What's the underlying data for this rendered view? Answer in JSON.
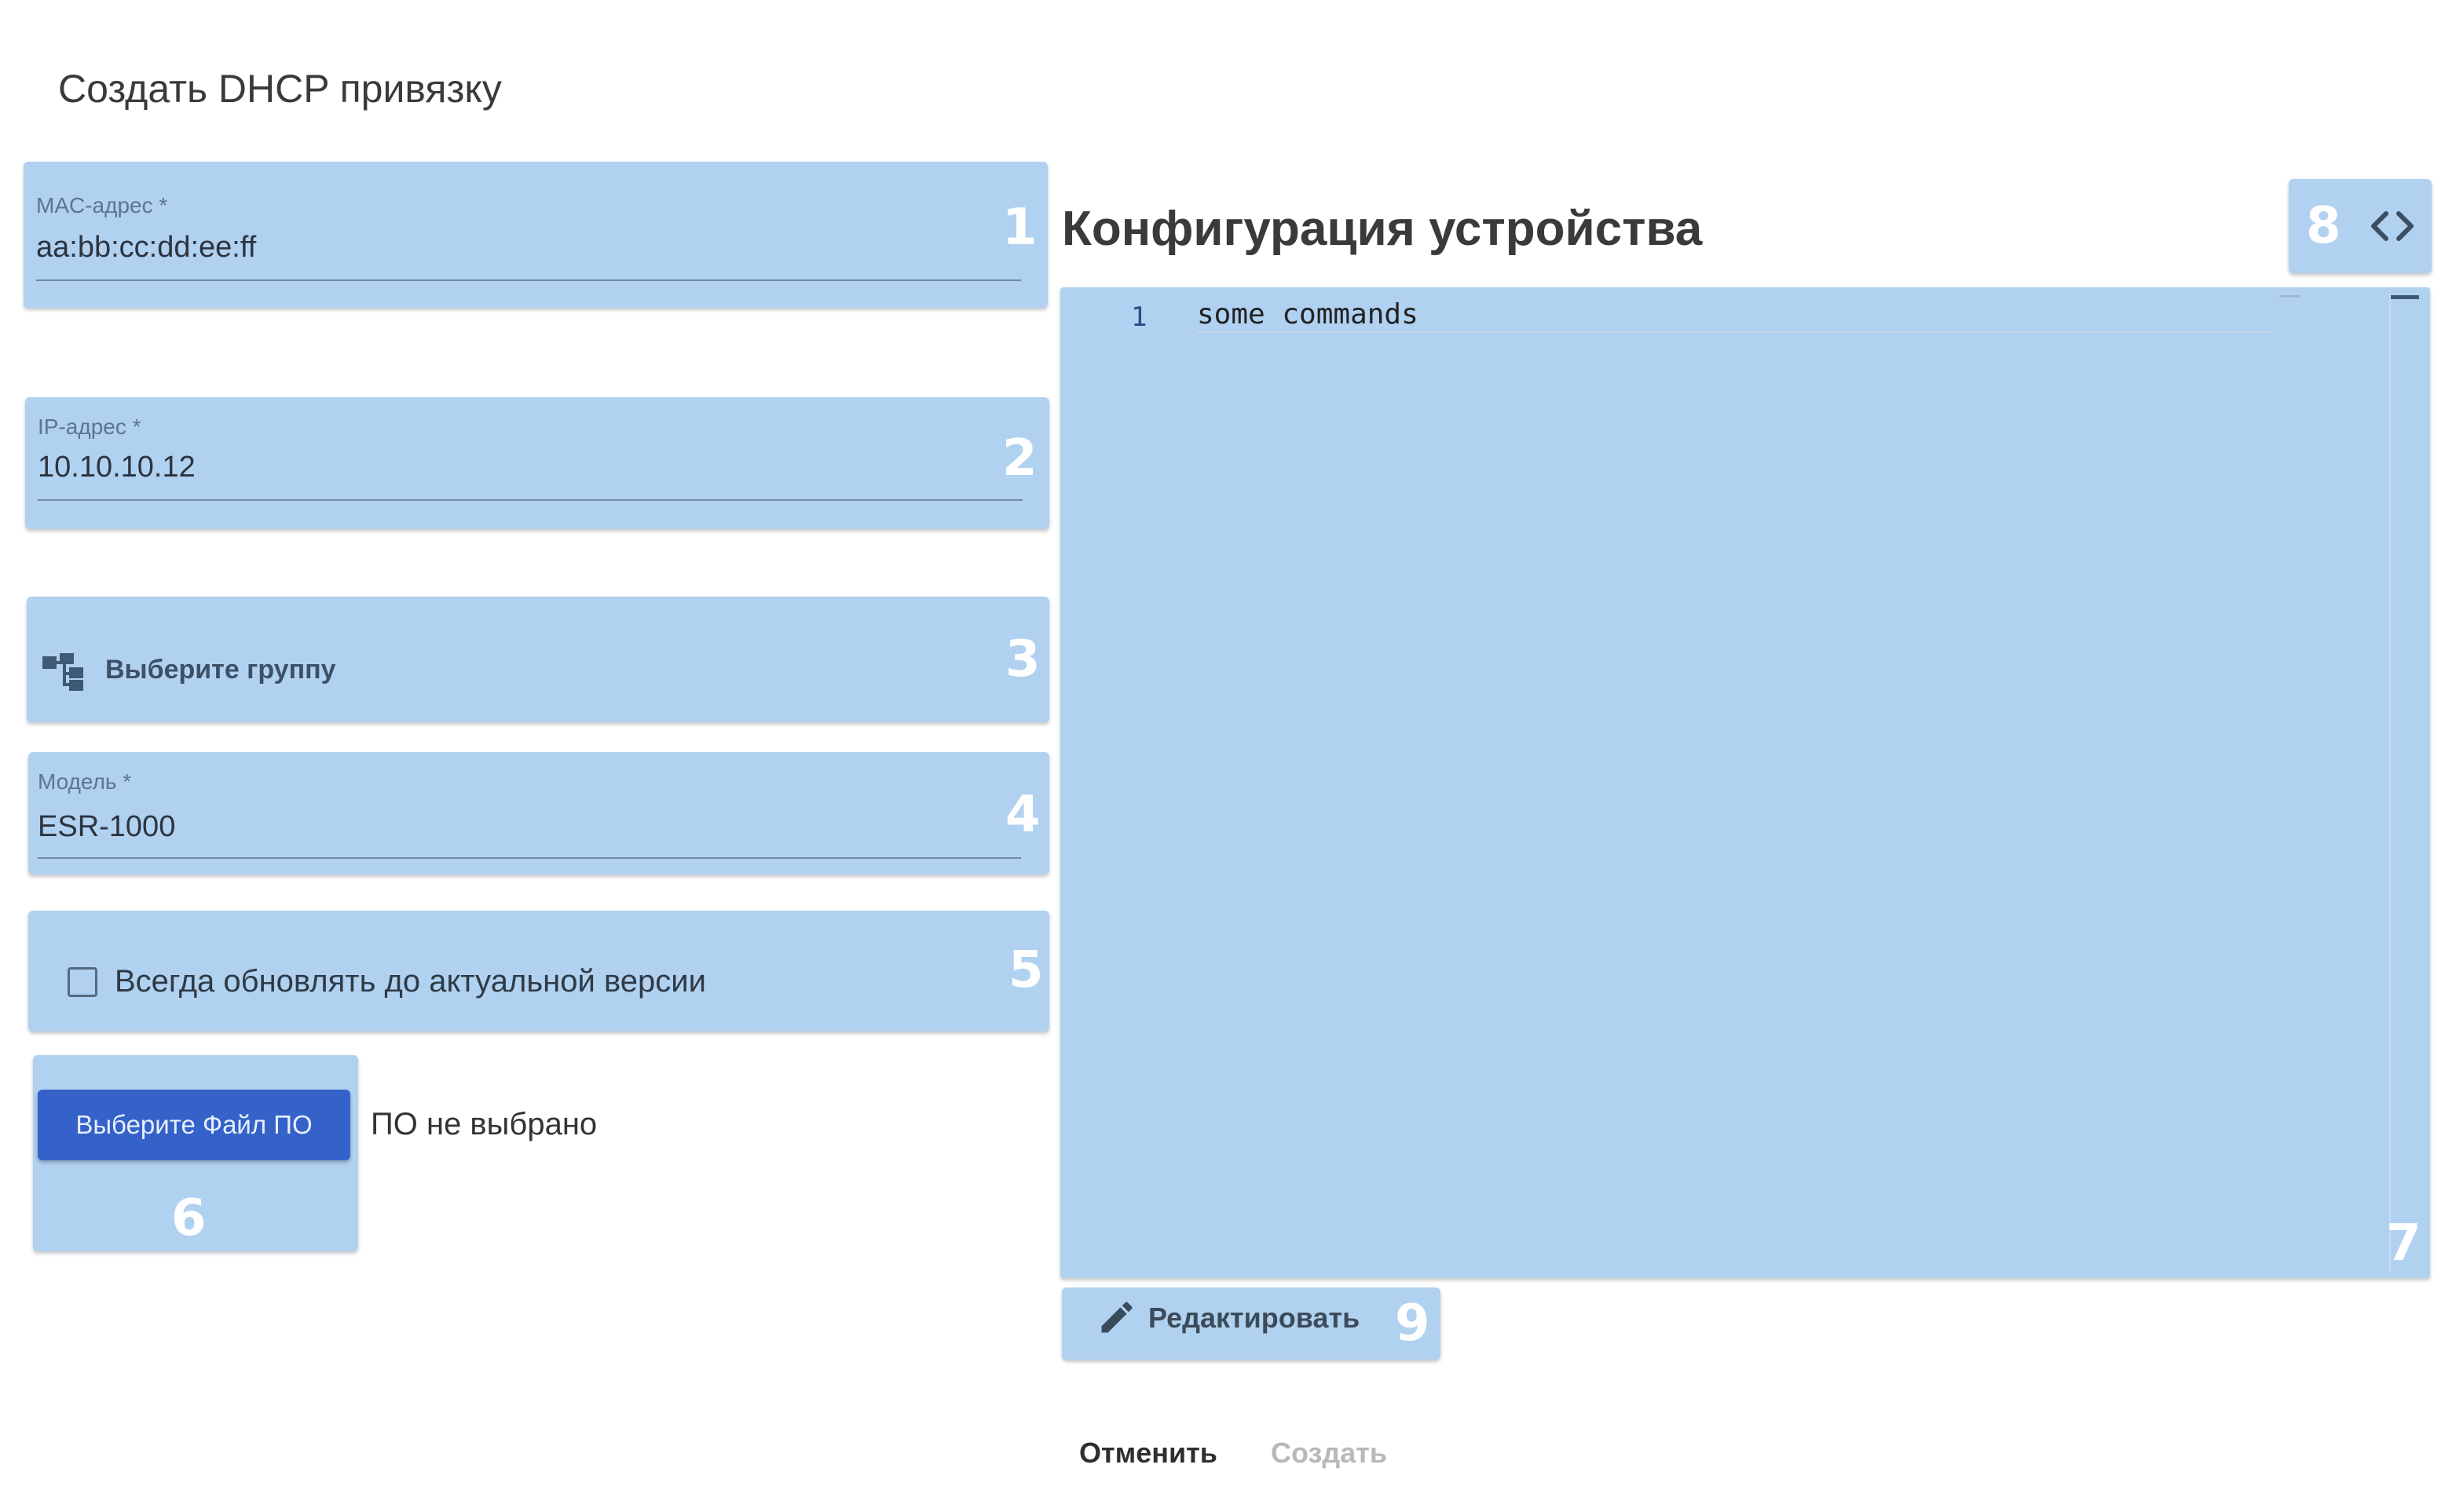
{
  "dialog": {
    "title": "Создать DHCP привязку"
  },
  "fields": {
    "mac": {
      "label": "MAC-адрес *",
      "value": "aa:bb:cc:dd:ee:ff",
      "badge": "1"
    },
    "ip": {
      "label": "IP-адрес *",
      "value": "10.10.10.12",
      "badge": "2"
    },
    "group": {
      "label": "Выберите группу",
      "badge": "3",
      "icon": "group-tree-icon"
    },
    "model": {
      "label": "Модель *",
      "value": "ESR-1000",
      "badge": "4"
    },
    "auto_update": {
      "label": "Всегда обновлять до актуальной версии",
      "checked": false,
      "badge": "5"
    },
    "firmware": {
      "button_label": "Выберите Файл ПО",
      "status": "ПО не выбрано",
      "badge": "6"
    }
  },
  "config": {
    "title": "Конфигурация устройства",
    "editor": {
      "lines": [
        {
          "number": "1",
          "text": "some commands"
        }
      ],
      "badge": "7"
    },
    "source_toggle": {
      "icon": "code-icon",
      "badge": "8"
    },
    "edit_button": {
      "label": "Редактировать",
      "icon": "pencil-icon",
      "badge": "9"
    }
  },
  "footer": {
    "cancel_label": "Отменить",
    "create_label": "Создать",
    "create_enabled": false
  },
  "colors": {
    "highlight": "#b1d1f0",
    "primary_button": "#3462c9",
    "badge_text": "#ffffff",
    "disabled_text": "#b8b8b8"
  }
}
